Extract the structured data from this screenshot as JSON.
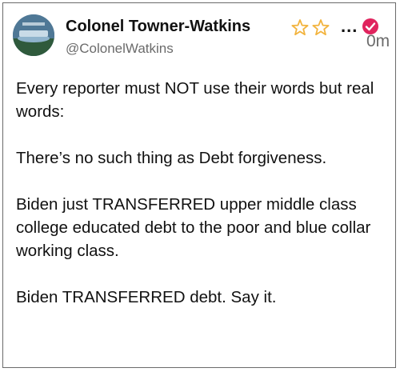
{
  "post": {
    "display_name": "Colonel Towner-Watkins",
    "handle": "@ColonelWatkins",
    "timestamp": "0m",
    "more": "...",
    "paragraphs": [
      "Every reporter must NOT use their words but real words:",
      "There’s no such thing as Debt forgiveness.",
      "Biden just TRANSFERRED upper middle class college educated debt to the poor and blue collar working class.",
      "Biden TRANSFERRED debt. Say it."
    ]
  },
  "icons": {
    "avatar": "profile-avatar",
    "stars": "star-outline-icon",
    "verified": "verified-badge-icon"
  },
  "colors": {
    "text": "#111111",
    "muted": "#6b6b6b",
    "star": "#f2b33d",
    "badge": "#e0245e"
  }
}
